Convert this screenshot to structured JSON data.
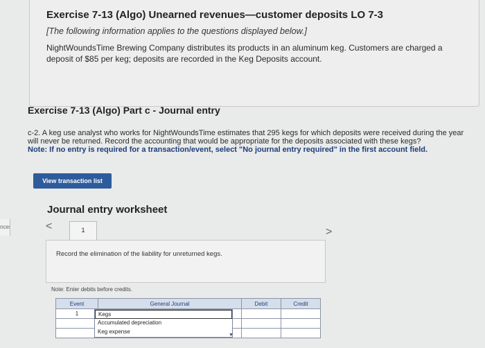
{
  "exercise": {
    "title": "Exercise 7-13 (Algo) Unearned revenues—customer deposits LO 7-3",
    "subtitle": "[The following information applies to the questions displayed below.]",
    "description": "NightWoundsTime Brewing Company distributes its products in an aluminum keg. Customers are charged a deposit of $85 per keg; deposits are recorded in the Keg Deposits account."
  },
  "sidebar_tab": "nces",
  "part": {
    "title": "Exercise 7-13 (Algo) Part c - Journal entry",
    "question": "c-2. A keg use analyst who works for NightWoundsTime estimates that 295 kegs for which deposits were received during the year will never be returned. Record the accounting that would be appropriate for the deposits associated with these kegs?",
    "note_label": "Note:",
    "note_text": "If no entry is required for a transaction/event, select \"No journal entry required\" in the first account field."
  },
  "buttons": {
    "view_transactions": "View transaction list"
  },
  "worksheet": {
    "title": "Journal entry worksheet",
    "prev": "<",
    "next": ">",
    "page": "1",
    "instruction": "Record the elimination of the liability for unreturned kegs.",
    "note_debits": "Note: Enter debits before credits."
  },
  "table": {
    "headers": [
      "Event",
      "General Journal",
      "Debit",
      "Credit"
    ],
    "row_event": "1"
  },
  "dropdown": {
    "options": [
      "Kegs",
      "Accumulated depreciation",
      "Keg expense"
    ],
    "selected_index": 0
  }
}
